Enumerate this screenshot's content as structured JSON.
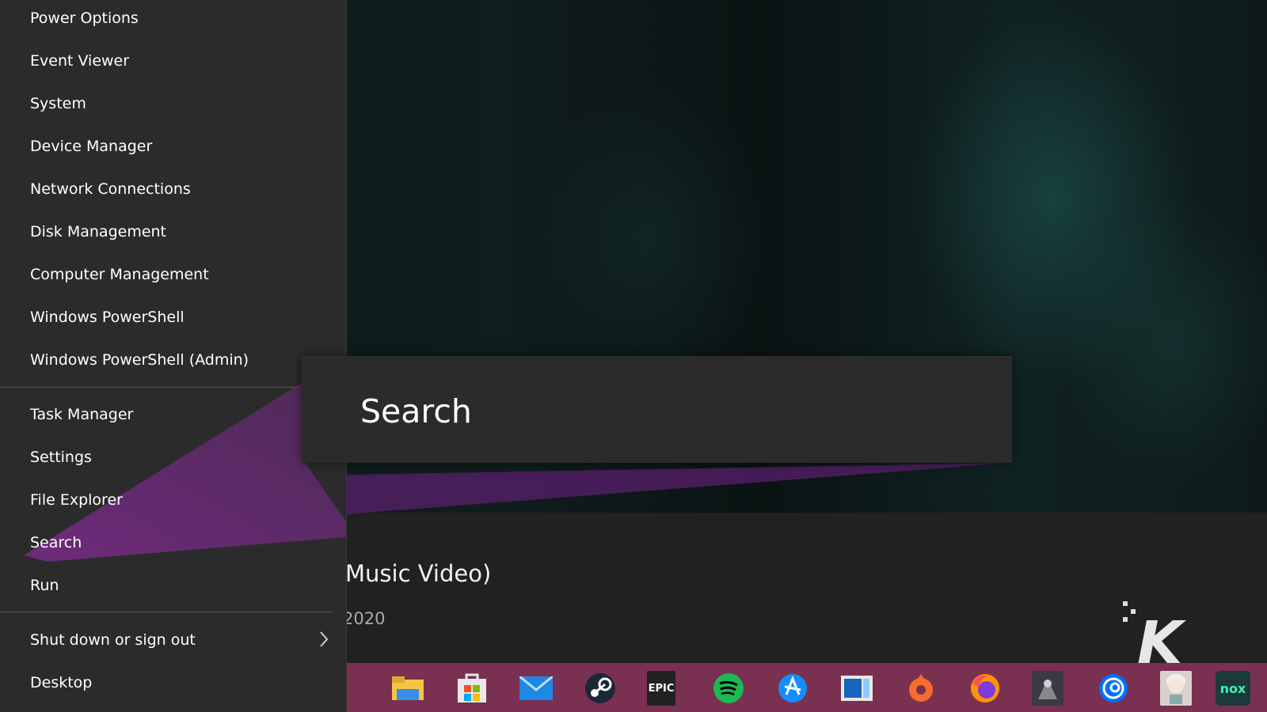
{
  "menu": {
    "items_top": [
      {
        "label": "Power Options"
      },
      {
        "label": "Event Viewer"
      },
      {
        "label": "System"
      },
      {
        "label": "Device Manager"
      },
      {
        "label": "Network Connections"
      },
      {
        "label": "Disk Management"
      },
      {
        "label": "Computer Management"
      },
      {
        "label": "Windows PowerShell"
      },
      {
        "label": "Windows PowerShell (Admin)"
      }
    ],
    "items_mid": [
      {
        "label": "Task Manager"
      },
      {
        "label": "Settings"
      },
      {
        "label": "File Explorer"
      },
      {
        "label": "Search"
      },
      {
        "label": "Run"
      }
    ],
    "items_bottom": [
      {
        "label": "Shut down or sign out"
      },
      {
        "label": "Desktop"
      }
    ]
  },
  "tooltip": {
    "label": "Search"
  },
  "video": {
    "title": "Music Video)",
    "date": "2020"
  },
  "watermark": {
    "label": "K"
  },
  "taskbar": {
    "icons": [
      "file-explorer-icon",
      "microsoft-store-icon",
      "mail-icon",
      "steam-icon",
      "epic-games-icon",
      "spotify-icon",
      "battle-net-icon",
      "photo-app-icon",
      "origin-icon",
      "firefox-icon",
      "game-shortcut-icon",
      "uplay-icon",
      "anime-app-icon",
      "nox-icon"
    ],
    "epic_label": "EPIC",
    "nox_label": "nox"
  },
  "colors": {
    "accent": "#7a2a8a",
    "taskbar": "#7a3050",
    "menu": "#2b2b2b"
  }
}
